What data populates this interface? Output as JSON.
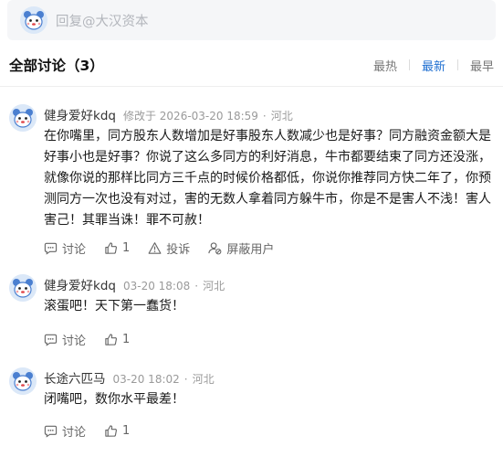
{
  "reply": {
    "placeholder": "回复@大汉资本"
  },
  "header": {
    "title": "全部讨论（3）",
    "sort": [
      "最热",
      "最新",
      "最早"
    ],
    "active_sort": "最新"
  },
  "comments": [
    {
      "user": "健身爱好kdq",
      "edited": "修改于 2026-03-20 18:59",
      "location": "河北",
      "text": "在你嘴里，同方股东人数增加是好事股东人数减少也是好事？同方融资金额大是好事小也是好事？你说了这么多同方的利好消息，牛市都要结束了同方还没涨，就像你说的那样比同方三千点的时候价格都低，你说你推荐同方快二年了，你预测同方一次也没有对过，害的无数人拿着同方躲牛市，你是不是害人不浅！害人害己！其罪当诛！罪不可赦！",
      "actions": {
        "comment": "讨论",
        "like": "1",
        "report": "投诉",
        "block": "屏蔽用户"
      }
    },
    {
      "user": "健身爱好kdq",
      "edited": "03-20 18:08",
      "location": "河北",
      "text": "滚蛋吧！天下第一蠢货！",
      "actions": {
        "comment": "讨论",
        "like": "1"
      }
    },
    {
      "user": "长途六匹马",
      "edited": "03-20 18:02",
      "location": "河北",
      "text": "闭嘴吧，数你水平最差！",
      "actions": {
        "comment": "讨论",
        "like": "1"
      }
    }
  ],
  "icons": {
    "avatar": "bear-avatar-icon",
    "comment": "comment-bubble-icon",
    "like": "thumbs-up-icon",
    "report": "warning-triangle-icon",
    "block": "block-user-icon"
  },
  "colors": {
    "accent": "#1f6fd1",
    "meta": "#9a9a9a",
    "placeholder": "#b3b6bc"
  }
}
